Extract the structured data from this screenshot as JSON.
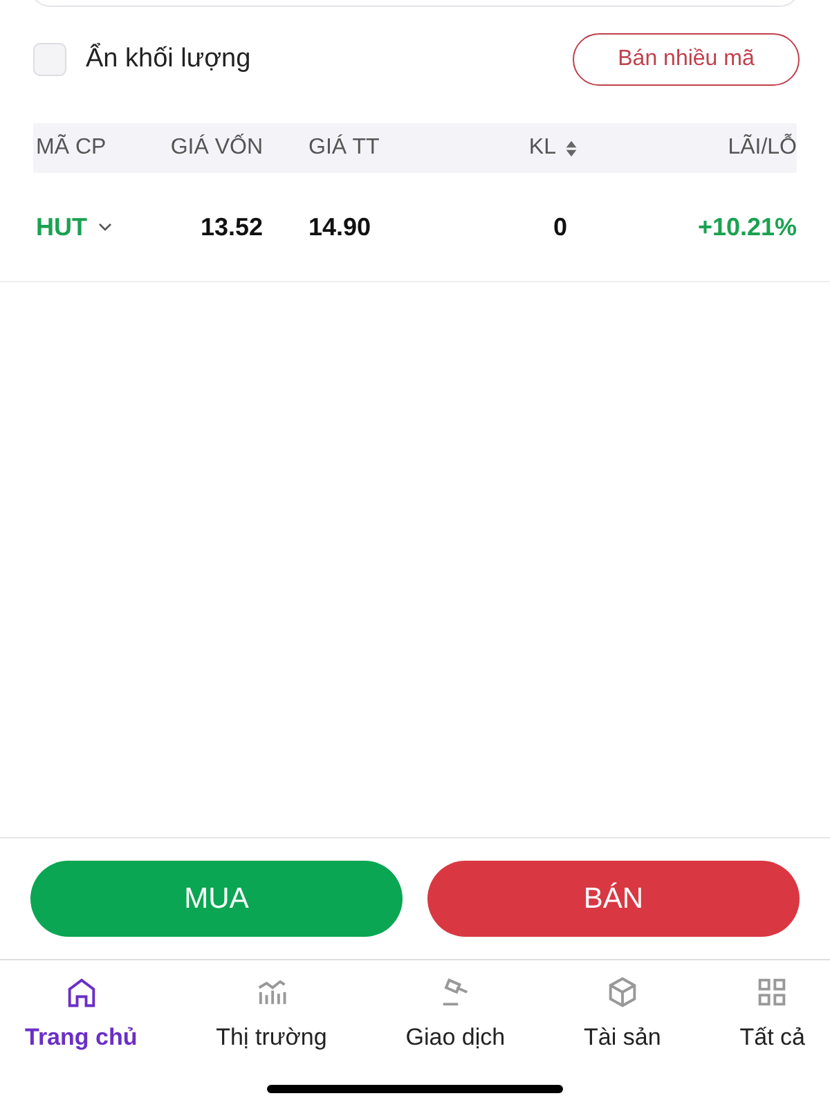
{
  "hide_volume": {
    "label": "Ẩn khối lượng",
    "checked": false
  },
  "sell_many_button": "Bán nhiều mã",
  "table": {
    "columns": [
      "MÃ CP",
      "GIÁ VỐN",
      "GIÁ TT",
      "KL",
      "LÃI/LỖ"
    ],
    "rows": [
      {
        "symbol": "HUT",
        "cost_price": "13.52",
        "market_price": "14.90",
        "volume": "0",
        "profit": "+10.21%",
        "color": "#1aa251"
      }
    ]
  },
  "buy_button": "MUA",
  "sell_button": "BÁN",
  "bottom_nav": [
    {
      "label": "Trang chủ",
      "selected": true
    },
    {
      "label": "Thị trường",
      "selected": false
    },
    {
      "label": "Giao dịch",
      "selected": false
    },
    {
      "label": "Tài sản",
      "selected": false
    },
    {
      "label": "Tất cả",
      "selected": false
    }
  ]
}
